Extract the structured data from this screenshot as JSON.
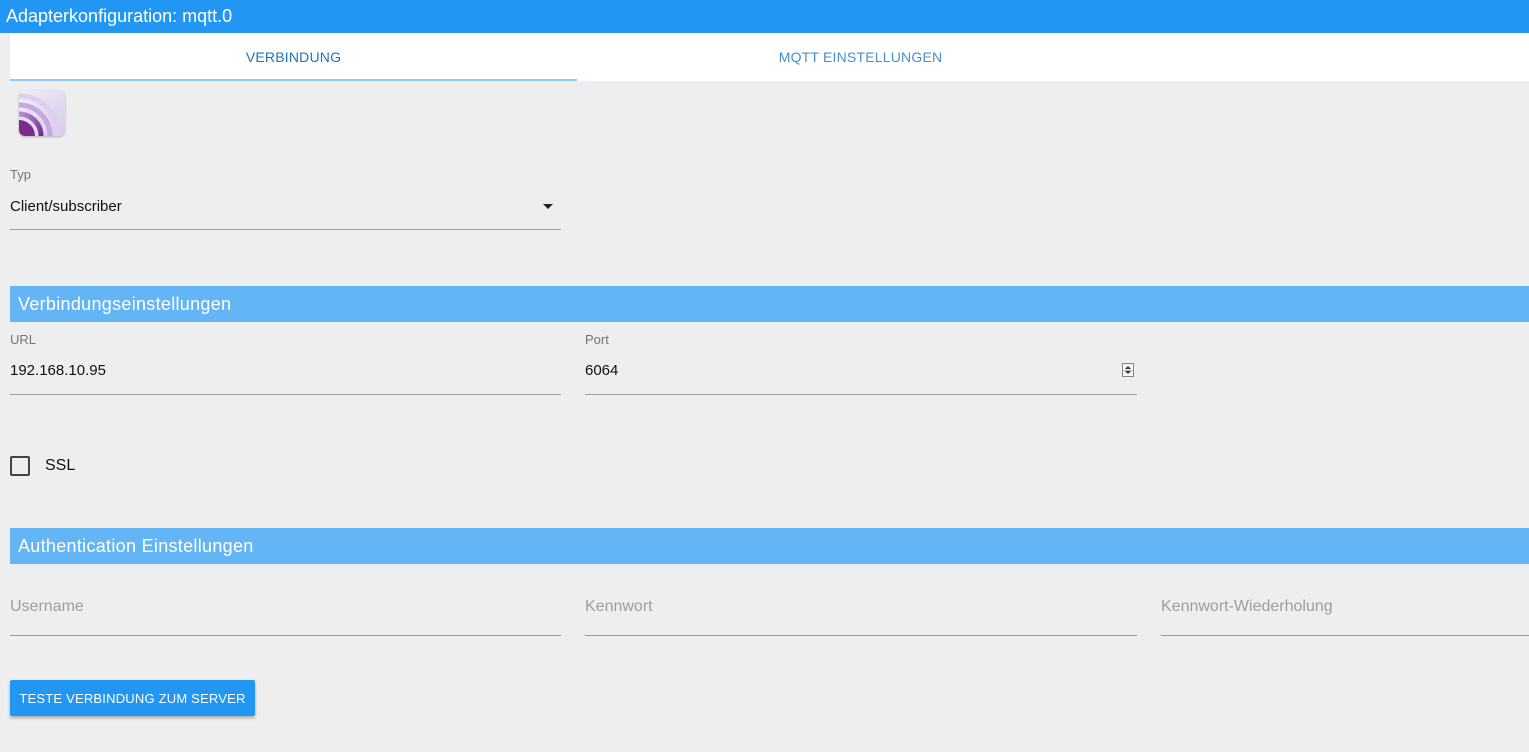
{
  "window": {
    "title": "Adapterkonfiguration: mqtt.0"
  },
  "tabs": [
    {
      "label": "VERBINDUNG",
      "active": true
    },
    {
      "label": "MQTT EINSTELLUNGEN",
      "active": false
    }
  ],
  "logo": {
    "icon": "mqtt-logo-icon"
  },
  "typ": {
    "label": "Typ",
    "value": "Client/subscriber"
  },
  "connection_section": {
    "title": "Verbindungseinstellungen",
    "url": {
      "label": "URL",
      "value": "192.168.10.95"
    },
    "port": {
      "label": "Port",
      "value": "6064"
    },
    "ssl": {
      "label": "SSL",
      "checked": false
    }
  },
  "auth_section": {
    "title": "Authentication Einstellungen",
    "username_placeholder": "Username",
    "password_placeholder": "Kennwort",
    "password_repeat_placeholder": "Kennwort-Wiederholung"
  },
  "actions": {
    "test_button_label": "TESTE VERBINDUNG ZUM SERVER"
  },
  "colors": {
    "accent": "#2196f3",
    "section_header": "#64b5f6",
    "background": "#eeeeee"
  }
}
